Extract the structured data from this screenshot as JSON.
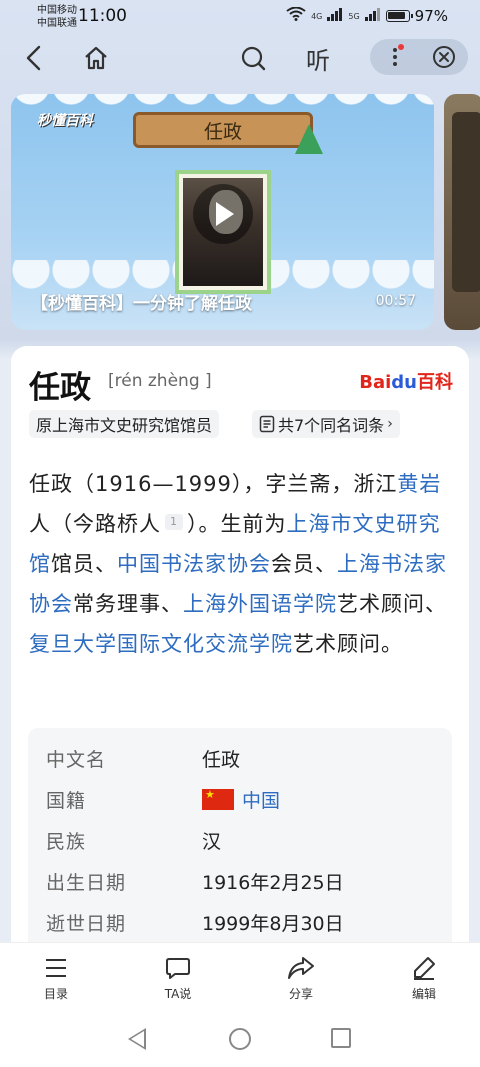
{
  "status_bar": {
    "carrier_1": "中国移动",
    "carrier_2": "中国联通",
    "time": "11:00",
    "signal_1": "4G",
    "signal_2": "5G",
    "battery": "97%"
  },
  "top_nav": {
    "listen_label": "听"
  },
  "video": {
    "brand": "秒懂百科",
    "sign_text": "任政",
    "title": "【秒懂百科】一分钟了解任政",
    "duration": "00:57"
  },
  "entry": {
    "title": "任政",
    "pinyin": "[rén zhèng ]",
    "baidu_logo": {
      "bai": "Bai",
      "paw": "du",
      "baike": "百科"
    },
    "tag_identity": "原上海市文史研究馆馆员",
    "tag_same_name": "共7个同名词条",
    "summary": {
      "p1": "任政（1916—1999），字兰斋，浙江",
      "link1": "黄岩",
      "p2": "人（今路桥人",
      "ref": "1",
      "p3": "）。生前为",
      "link2": "上海市文史研究馆",
      "p4": "馆员、",
      "link3": "中国书法家协会",
      "p5": "会员、",
      "link4": "上海书法家协会",
      "p6": "常务理事、",
      "link5": "上海外国语学院",
      "p7": "艺术顾问、",
      "link6": "复旦大学国际文化交流学院",
      "p8": "艺术顾问。"
    },
    "infobox": [
      {
        "key": "中文名",
        "value": "任政"
      },
      {
        "key": "国籍",
        "value": "中国"
      },
      {
        "key": "民族",
        "value": "汉"
      },
      {
        "key": "出生日期",
        "value": "1916年2月25日"
      },
      {
        "key": "逝世日期",
        "value": "1999年8月30日"
      }
    ]
  },
  "toolbar": {
    "catalog": "目录",
    "ta_say": "TA说",
    "share": "分享",
    "edit": "编辑"
  }
}
